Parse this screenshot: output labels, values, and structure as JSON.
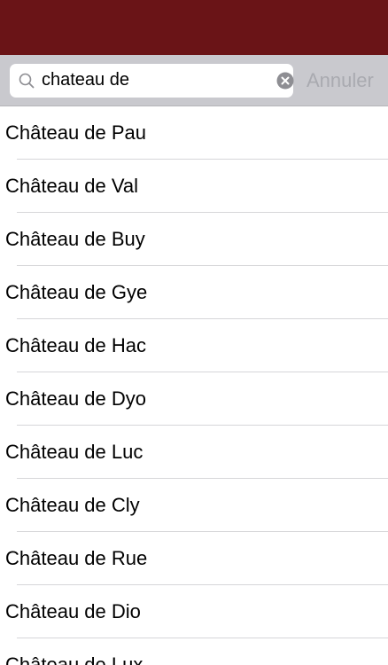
{
  "colors": {
    "header_bg": "#6a1417",
    "search_bar_bg": "#c9c9ce",
    "cancel_text": "#a9aab0"
  },
  "search": {
    "value": "chateau de",
    "cancel_label": "Annuler",
    "search_icon": "magnifier-icon",
    "clear_icon": "clear-circle-icon"
  },
  "results": [
    "Château de Pau",
    "Château de Val",
    "Château de Buy",
    "Château de Gye",
    "Château de Hac",
    "Château de Dyo",
    "Château de Luc",
    "Château de Cly",
    "Château de Rue",
    "Château de Dio",
    "Château de Lux"
  ]
}
